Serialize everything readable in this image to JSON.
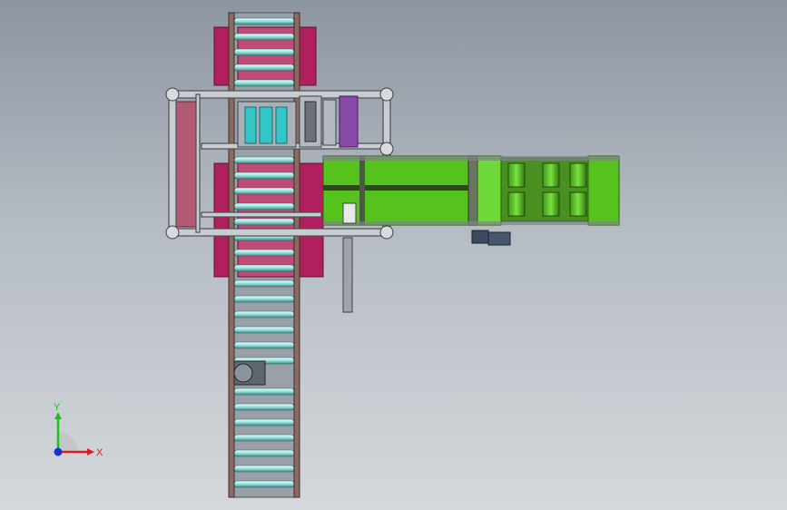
{
  "viewport": {
    "background_top": "#8d95a0",
    "background_bottom": "#d4d8dc"
  },
  "model": {
    "colors": {
      "frame": "#c9ccd0",
      "frame_dark": "#5a5e63",
      "roller": "#b9f0ec",
      "roller_shade": "#4e9c98",
      "bed": "#9aa0a8",
      "guard": "#b01f5e",
      "guard_light": "#c04a78",
      "green": "#56c21e",
      "green_dark": "#2f7a10",
      "green_light": "#6ed83a",
      "purple": "#8a4aa8",
      "cyan": "#34c6c6",
      "motor": "#3b4a5e"
    }
  },
  "triad": {
    "y_label": "Y",
    "x_label": "X",
    "y_color": "#17c417",
    "x_color": "#e01b1b",
    "z_color": "#1a2fd6"
  }
}
